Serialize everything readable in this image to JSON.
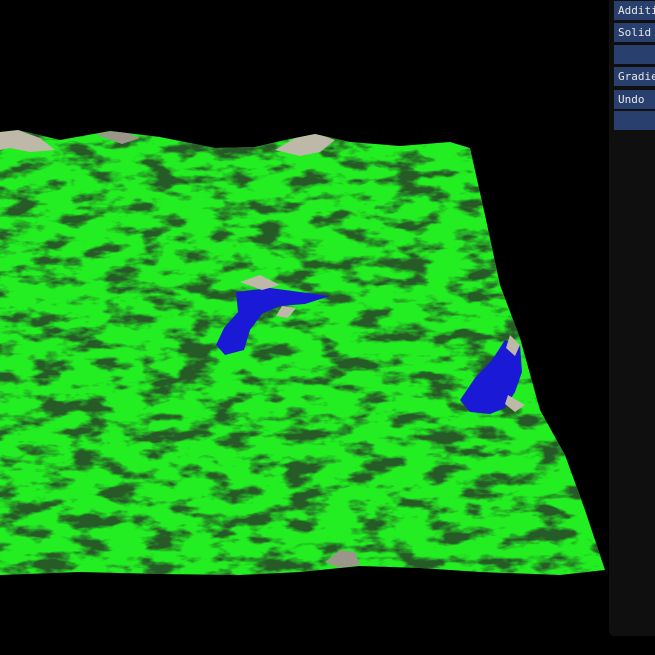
{
  "viewport": {
    "description": "3D heightmap terrain render",
    "colors": {
      "background": "#000000",
      "grass": "#22ee22",
      "shadow": "#041a04",
      "water": "#1a1ad6",
      "rock": "#bdb8a8"
    }
  },
  "panel": {
    "background": "#0f0f0f",
    "button_color": "#29406e",
    "buttons": [
      {
        "label": "Additi"
      },
      {
        "label": "Solid"
      },
      {
        "label": ""
      },
      {
        "label": "Gradie"
      },
      {
        "label": "Undo"
      },
      {
        "label": ""
      }
    ]
  }
}
